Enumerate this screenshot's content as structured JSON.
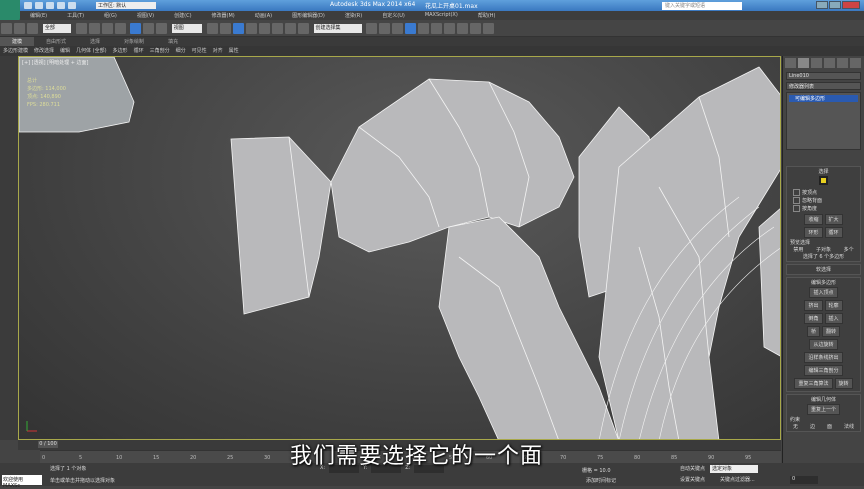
{
  "titlebar": {
    "app_title": "Autodesk 3ds Max 2014 x64",
    "file": "花瓜上开桌01.max",
    "workspace": "工作区: 默认",
    "search_placeholder": "键入关键字或短语"
  },
  "menu": [
    "编辑(E)",
    "工具(T)",
    "组(G)",
    "视图(V)",
    "创建(C)",
    "修改器(M)",
    "动画(A)",
    "图形编辑器(D)",
    "渲染(R)",
    "自定义(U)",
    "MAXScript(X)",
    "帮助(H)"
  ],
  "toolbar": {
    "selection_filter": "全部",
    "ref_coord": "视图",
    "named_sel": "创建选择集"
  },
  "ribbon": {
    "tabs": [
      "建模",
      "自由形式",
      "选择",
      "对象绘制",
      "填充"
    ],
    "items": [
      "多边形建模",
      "修改选择",
      "编辑",
      "几何体 (全部)",
      "多边形",
      "循环",
      "三角剖分",
      "细分",
      "可见性",
      "对齐",
      "属性"
    ]
  },
  "viewport": {
    "label": "[+] [透视] [明暗处理 + 边面]",
    "stats": [
      "总计",
      "多边形: 114,000",
      "顶点: 140,890",
      "FPS: 280.711"
    ]
  },
  "command_panel": {
    "object_name": "Line010",
    "modifier_list": "修改器列表",
    "stack_item": "可编辑多边形",
    "selection_title": "选择",
    "by_vertex": "按顶点",
    "ignore_backface": "忽略背面",
    "by_angle": "按角度",
    "shrink": "收缩",
    "grow": "扩大",
    "ring": "环形",
    "loop": "循环",
    "preview_title": "预览选择",
    "preview_off": "禁用",
    "preview_subobj": "子对象",
    "preview_multi": "多个",
    "sel_status": "选择了 6 个多边形",
    "soft_sel": "软选择",
    "edit_poly": "编辑多边形",
    "insert_vertex": "插入顶点",
    "extrude": "挤出",
    "outline": "轮廓",
    "bevel": "倒角",
    "inset": "插入",
    "bridge": "桥",
    "flip": "翻转",
    "hinge": "从边旋转",
    "extrude_spline": "沿样条线挤出",
    "edit_tri": "编辑三角剖分",
    "retri": "重复三角算法",
    "turn": "旋转",
    "edit_geo": "编辑几何体",
    "repeat_last": "重复上一个",
    "constraints": "约束",
    "c_none": "无",
    "c_edge": "边",
    "c_face": "面",
    "c_normal": "法线"
  },
  "timeline": {
    "frame": "0 / 100",
    "ticks": [
      "0",
      "5",
      "10",
      "15",
      "20",
      "25",
      "30",
      "35",
      "40",
      "45",
      "50",
      "55",
      "60",
      "65",
      "70",
      "75",
      "80",
      "85",
      "90",
      "95"
    ]
  },
  "status": {
    "welcome": "欢迎使用 MAXSc",
    "msg1": "选择了 1 个对象",
    "msg2": "单击或单击并拖动以选择对象",
    "x": "X:",
    "y": "Y:",
    "z": "Z:",
    "grid": "栅格 = 10.0",
    "add_time_tag": "添加时间标记",
    "auto_key": "自动关键点",
    "set_key": "设置关键点",
    "key_select": "选定对象",
    "key_filters": "关键点过滤器...",
    "frame_value": "0"
  },
  "subtitle": "我们需要选择它的一个面"
}
